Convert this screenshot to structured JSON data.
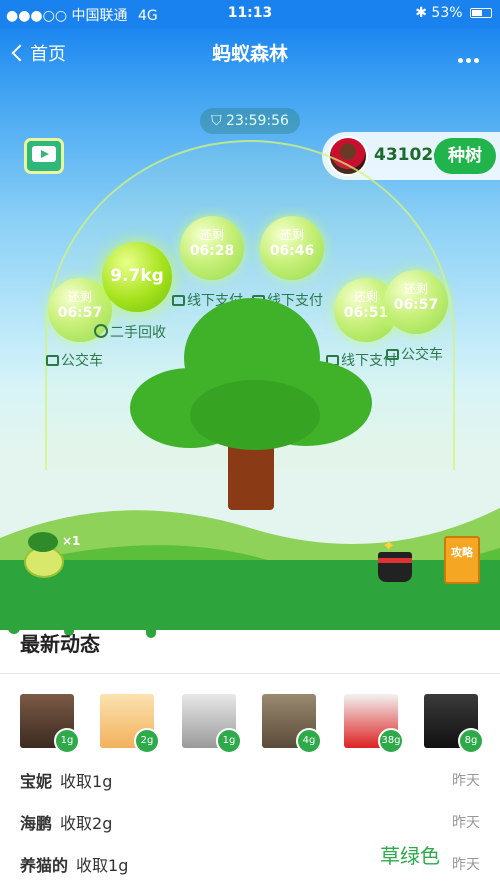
{
  "status_bar": {
    "carrier": "●●●○○ 中国联通",
    "network": "4G",
    "time": "11:13",
    "battery": "53%",
    "battery_level": 0.53
  },
  "nav": {
    "back_label": "首页",
    "title": "蚂蚁森林"
  },
  "timer": "23:59:56",
  "energy": {
    "total": "43102g",
    "plant_button": "种树"
  },
  "bubbles": [
    {
      "label": "还剩",
      "time": "06:57"
    },
    {
      "label": "还剩",
      "time": "06:28"
    },
    {
      "label": "还剩",
      "time": "06:46"
    },
    {
      "label": "还剩",
      "time": "06:51"
    },
    {
      "label": "还剩",
      "time": "06:57"
    }
  ],
  "big_bubble": {
    "value": "9.7kg"
  },
  "sources": [
    "线下支付",
    "线下支付",
    "二手回收",
    "公交车",
    "线下支付",
    "公交车"
  ],
  "tree_badge": "×1",
  "guide_label": "攻略",
  "feed": {
    "title": "最新动态",
    "avatars": [
      {
        "amount": "1g"
      },
      {
        "amount": "2g"
      },
      {
        "amount": "1g"
      },
      {
        "amount": "4g"
      },
      {
        "amount": "38g"
      },
      {
        "amount": "8g"
      }
    ],
    "rows": [
      {
        "name": "宝妮",
        "action": "收取1g",
        "when": "昨天"
      },
      {
        "name": "海鹏",
        "action": "收取2g",
        "when": "昨天"
      },
      {
        "name": "养猫的",
        "action": "收取1g",
        "when": "昨天"
      }
    ]
  },
  "watermark": "草绿色",
  "colors": {
    "status_bar": "#1a82ef",
    "primary_green": "#21b44d",
    "grass": "#2ea43c"
  }
}
